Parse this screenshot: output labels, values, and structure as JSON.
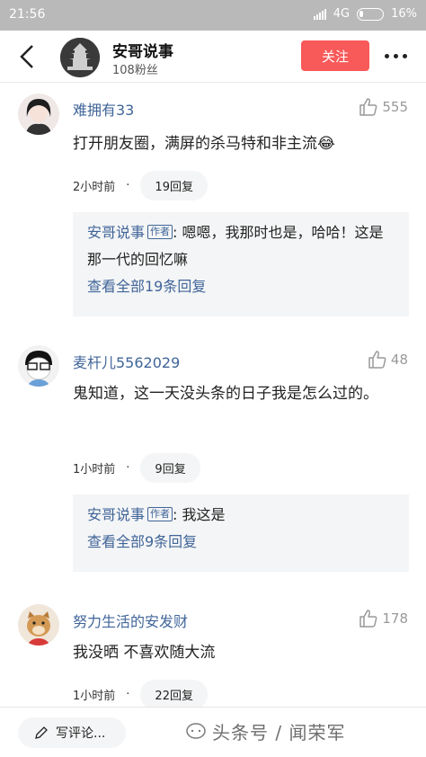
{
  "status": {
    "time": "21:56",
    "network": "4G",
    "battery": "16%"
  },
  "header": {
    "name": "安哥说事",
    "fans": "108粉丝",
    "follow_label": "关注"
  },
  "comments": [
    {
      "name": "难拥有33",
      "likes": "555",
      "text": "打开朋友圈，满屏的杀马特和非主流😂",
      "time": "2小时前",
      "dot": "·",
      "replies_btn": "19回复",
      "reply": {
        "author": "安哥说事",
        "tag": "作者",
        "text": ": 嗯嗯，我那时也是，哈哈！这是那一代的回忆嘛",
        "view_all": "查看全部19条回复"
      }
    },
    {
      "name": "麦杆儿5562029",
      "likes": "48",
      "text": "鬼知道，这一天没头条的日子我是怎么过的。",
      "time": "1小时前",
      "dot": "·",
      "replies_btn": "9回复",
      "reply": {
        "author": "安哥说事",
        "tag": "作者",
        "text": ": 我这是",
        "view_all": "查看全部9条回复"
      }
    },
    {
      "name": "努力生活的安发财",
      "likes": "178",
      "text": "我没晒 不喜欢随大流",
      "time": "1小时前",
      "dot": "·",
      "replies_btn": "22回复"
    }
  ],
  "bottom": {
    "write_placeholder": "写评论...",
    "watermark": "头条号 / 闻荣军"
  },
  "colors": {
    "accent": "#f85959",
    "link": "#406599",
    "statusbar": "#b9b9b9"
  }
}
